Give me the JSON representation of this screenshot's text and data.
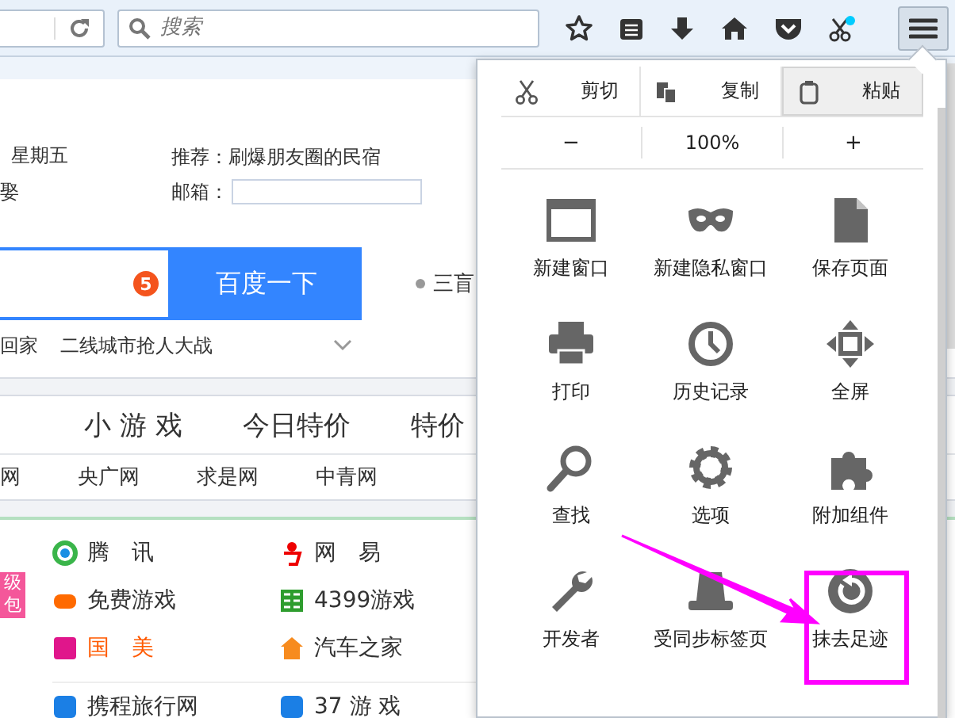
{
  "toolbar": {
    "search_placeholder": "搜索",
    "menu_button_pressed": true
  },
  "page": {
    "date": "星期五",
    "almanac": "娶",
    "recommend_label": "推荐：",
    "recommend_link": "刷爆朋友圈的民宿",
    "mail_label": "邮箱：",
    "search_badge": "5",
    "search_button": "百度一下",
    "hot_item": "三盲",
    "hot_links": [
      "回家",
      "二线城市抢人大战"
    ],
    "nav": [
      "小 游 戏",
      "今日特价",
      "特价"
    ],
    "sites": [
      "网",
      "央广网",
      "求是网",
      "中青网"
    ],
    "side_badge": "级包",
    "links": [
      {
        "label": "腾　讯",
        "color": "#333333"
      },
      {
        "label": "网　易",
        "color": "#333333"
      },
      {
        "label": "免费游戏",
        "color": "#333333"
      },
      {
        "label": "4399游戏",
        "color": "#333333"
      },
      {
        "label": "国　美",
        "color": "#ff5a00"
      },
      {
        "label": "汽车之家",
        "color": "#333333"
      },
      {
        "label": "携程旅行网",
        "color": "#333333"
      },
      {
        "label": "37 游 戏",
        "color": "#333333"
      }
    ]
  },
  "menu": {
    "edit": [
      {
        "label": "剪切",
        "hovered": false
      },
      {
        "label": "复制",
        "hovered": false
      },
      {
        "label": "粘贴",
        "hovered": true
      }
    ],
    "zoom_out": "−",
    "zoom": "100%",
    "zoom_in": "+",
    "items": [
      {
        "label": "新建窗口"
      },
      {
        "label": "新建隐私窗口"
      },
      {
        "label": "保存页面"
      },
      {
        "label": "打印"
      },
      {
        "label": "历史记录"
      },
      {
        "label": "全屏"
      },
      {
        "label": "查找"
      },
      {
        "label": "选项"
      },
      {
        "label": "附加组件"
      },
      {
        "label": "开发者"
      },
      {
        "label": "受同步标签页"
      },
      {
        "label": "抹去足迹"
      }
    ]
  }
}
